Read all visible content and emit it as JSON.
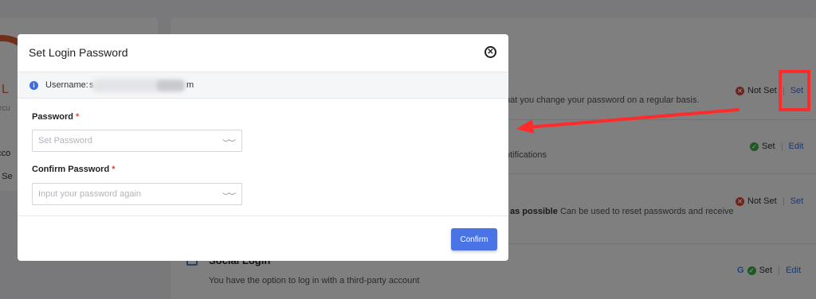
{
  "background": {
    "left_card": {
      "level_text": "L",
      "subtitle": "Secu",
      "account_text": "acco",
      "not_set_text": "ot Se"
    },
    "rows": [
      {
        "description": "hat you change your password on a regular basis.",
        "status": "Not Set",
        "status_color": "#e0443a",
        "action": "Set"
      },
      {
        "description": "otifications",
        "status": "Set",
        "status_color": "#3bb54a",
        "action": "Edit"
      },
      {
        "description_bold": "as possible",
        "description": "Can be used to reset passwords and receive",
        "status": "Not Set",
        "status_color": "#e0443a",
        "action": "Set"
      },
      {
        "title": "Social Login",
        "description": "You have the option to log in with a third-party account",
        "provider_icon": "G",
        "status": "Set",
        "status_color": "#3bb54a",
        "action": "Edit"
      }
    ],
    "annotation_color": "#ff2b2b"
  },
  "modal": {
    "title": "Set Login Password",
    "close_icon": "close-icon",
    "username_label": "Username:",
    "username_visible_start": "s",
    "username_visible_end": "m",
    "fields": [
      {
        "label": "Password",
        "required_mark": "*",
        "placeholder": "Set Password",
        "value": ""
      },
      {
        "label": "Confirm Password",
        "required_mark": "*",
        "placeholder": "Input your password again",
        "value": ""
      }
    ],
    "confirm_label": "Confirm",
    "accent_color": "#4a74e6"
  }
}
